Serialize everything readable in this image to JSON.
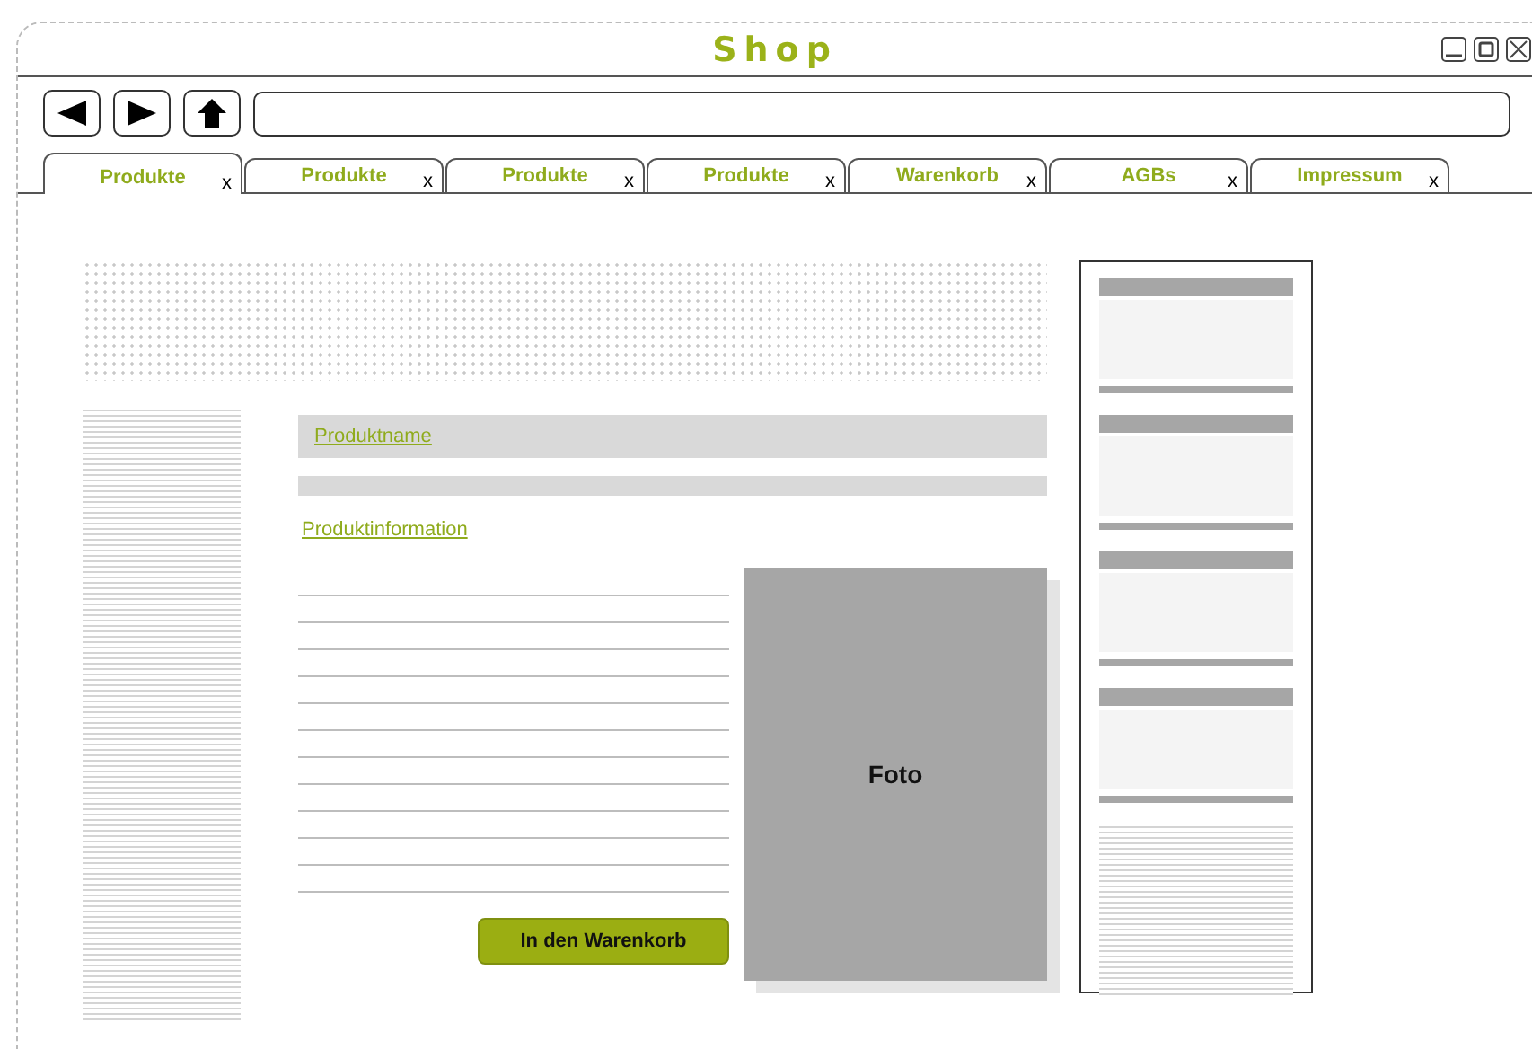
{
  "window": {
    "title": "Shop"
  },
  "tabs": [
    {
      "label": "Produkte",
      "close": "x",
      "selected": true
    },
    {
      "label": "Produkte",
      "close": "x",
      "selected": false
    },
    {
      "label": "Produkte",
      "close": "x",
      "selected": false
    },
    {
      "label": "Produkte",
      "close": "x",
      "selected": false
    },
    {
      "label": "Warenkorb",
      "close": "x",
      "selected": false
    },
    {
      "label": "AGBs",
      "close": "x",
      "selected": false
    },
    {
      "label": "Impressum",
      "close": "x",
      "selected": false
    }
  ],
  "product": {
    "name_link": "Produktname",
    "info_link": "Produktinformation",
    "photo_label": "Foto",
    "cart_button": "In den Warenkorb"
  }
}
